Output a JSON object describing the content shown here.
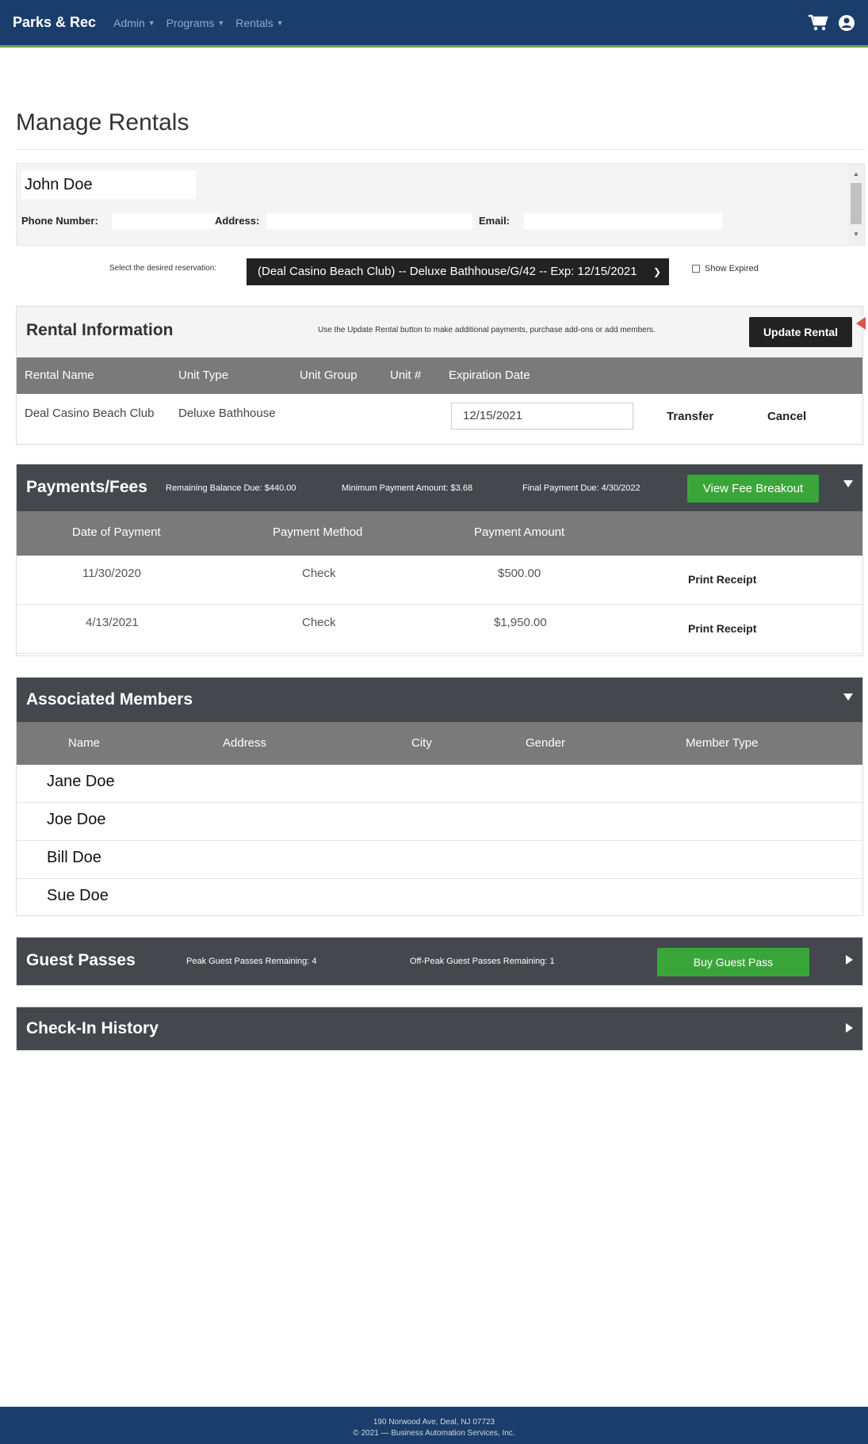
{
  "nav": {
    "brand": "Parks & Rec",
    "items": [
      {
        "label": "Admin"
      },
      {
        "label": "Programs"
      },
      {
        "label": "Rentals"
      }
    ],
    "icons": [
      "cart-icon",
      "user-circle-icon"
    ]
  },
  "page": {
    "title": "Manage Rentals"
  },
  "customer": {
    "name": "John Doe",
    "phone_label": "Phone Number:",
    "address_label": "Address:",
    "email_label": "Email:"
  },
  "reservation": {
    "label": "Select the desired reservation:",
    "selected": "(Deal Casino Beach Club) -- Deluxe Bathhouse/G/42 -- Exp: 12/15/2021",
    "show_expired_label": "Show Expired"
  },
  "rental_info": {
    "title": "Rental Information",
    "hint": "Use the Update Rental button to make additional payments, purchase add-ons or add members.",
    "update_button": "Update Rental",
    "columns": [
      "Rental Name",
      "Unit Type",
      "Unit Group",
      "Unit #",
      "Expiration Date"
    ],
    "row": {
      "rental_name": "Deal Casino Beach Club",
      "unit_type": "Deluxe Bathhouse",
      "expiration": "12/15/2021",
      "transfer": "Transfer",
      "cancel": "Cancel"
    }
  },
  "payments": {
    "title": "Payments/Fees",
    "remaining_balance": "Remaining Balance Due: $440.00",
    "minimum_payment": "Minimum Payment Amount: $3.68",
    "final_due": "Final Payment Due: 4/30/2022",
    "fee_button": "View Fee Breakout",
    "columns": [
      "Date of Payment",
      "Payment Method",
      "Payment Amount"
    ],
    "rows": [
      {
        "date": "11/30/2020",
        "method": "Check",
        "amount": "$500.00",
        "action": "Print Receipt"
      },
      {
        "date": "4/13/2021",
        "method": "Check",
        "amount": "$1,950.00",
        "action": "Print Receipt"
      }
    ]
  },
  "members": {
    "title": "Associated Members",
    "columns": [
      "Name",
      "Address",
      "City",
      "Gender",
      "Member Type"
    ],
    "rows": [
      "Jane Doe",
      "Joe Doe",
      "Bill Doe",
      "Sue Doe"
    ]
  },
  "guest": {
    "title": "Guest Passes",
    "peak": "Peak Guest Passes Remaining: 4",
    "offpeak": "Off-Peak Guest Passes Remaining: 1",
    "button": "Buy Guest Pass"
  },
  "checkin": {
    "title": "Check-In History"
  },
  "footer": {
    "address": "190 Norwood Ave, Deal, NJ 07723",
    "copyright": "© 2021 — Business Automation Services, Inc."
  },
  "colors": {
    "navbar": "#1b3d6b",
    "nav_accent": "#6da34d",
    "dark_header": "#44484d",
    "table_header": "#7a7a7a",
    "green_button": "#3aa63a",
    "arrow": "#d9534f"
  }
}
